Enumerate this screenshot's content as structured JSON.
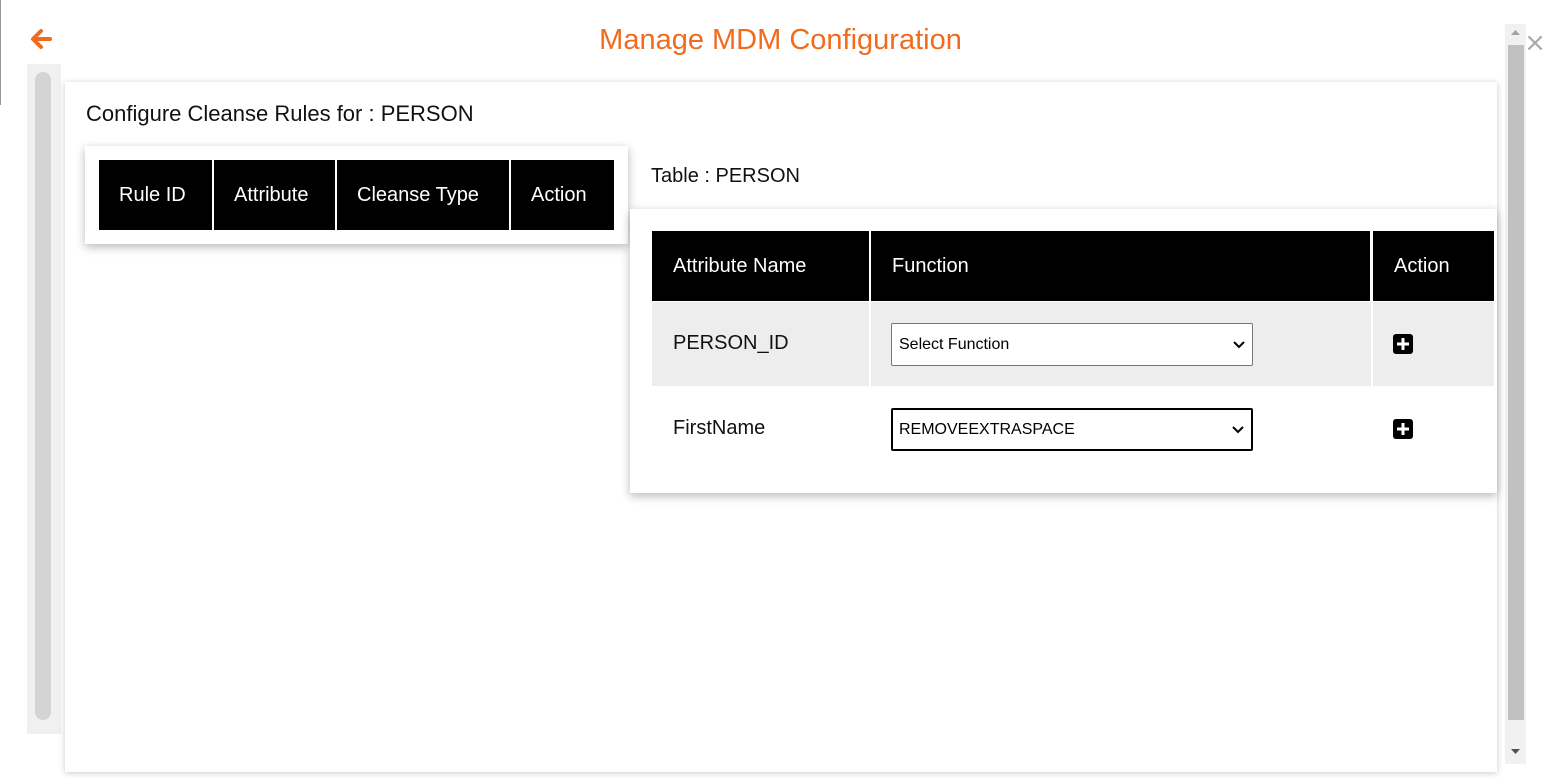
{
  "header": {
    "title": "Manage MDM Configuration",
    "back_icon": "arrow-left-icon",
    "close_label": "×",
    "accent_color": "#f26b1d"
  },
  "card": {
    "title": "Configure Cleanse Rules for : PERSON"
  },
  "rules_table": {
    "columns": [
      "Rule ID",
      "Attribute",
      "Cleanse Type",
      "Action"
    ],
    "rows": []
  },
  "attribute_table": {
    "caption": "Table : PERSON",
    "columns": [
      "Attribute Name",
      "Function",
      "Action"
    ],
    "rows": [
      {
        "attribute": "PERSON_ID",
        "function": "Select Function",
        "action_icon": "plus-square-icon"
      },
      {
        "attribute": "FirstName",
        "function": "REMOVEEXTRASPACE",
        "action_icon": "plus-square-icon"
      }
    ]
  }
}
